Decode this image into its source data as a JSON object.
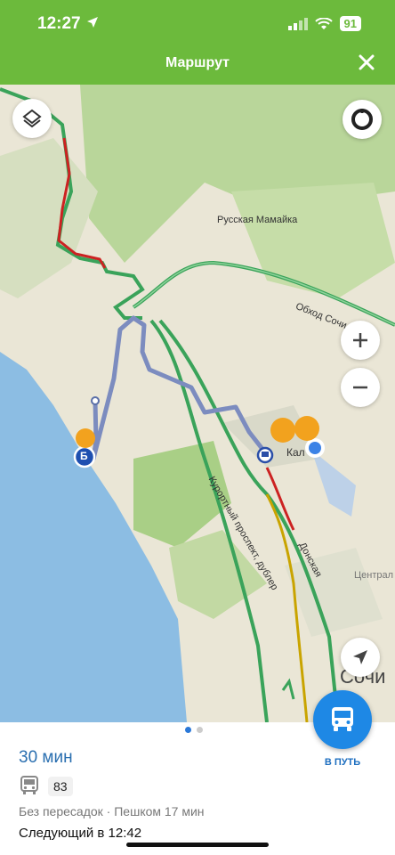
{
  "status_bar": {
    "time": "12:27",
    "battery": "91"
  },
  "header": {
    "title": "Маршрут"
  },
  "map": {
    "labels": {
      "russkaya_mamaika": "Русская Мамайка",
      "obkhod_sochi": "Обход Сочи",
      "kurortny": "Курортный проспект, дублер",
      "donskaya": "Донская",
      "central": "Централ",
      "kal": "Кал",
      "start_marker": "Б",
      "city": "Сочи"
    }
  },
  "route": {
    "duration": "30 мин",
    "bus_number": "83",
    "transfers": "Без пересадок",
    "separator": "·",
    "walking": "Пешком 17 мин",
    "next": "Следующий в 12:42",
    "go_label": "В ПУТЬ"
  },
  "colors": {
    "header": "#6cba3c",
    "accent": "#1e88e5"
  }
}
